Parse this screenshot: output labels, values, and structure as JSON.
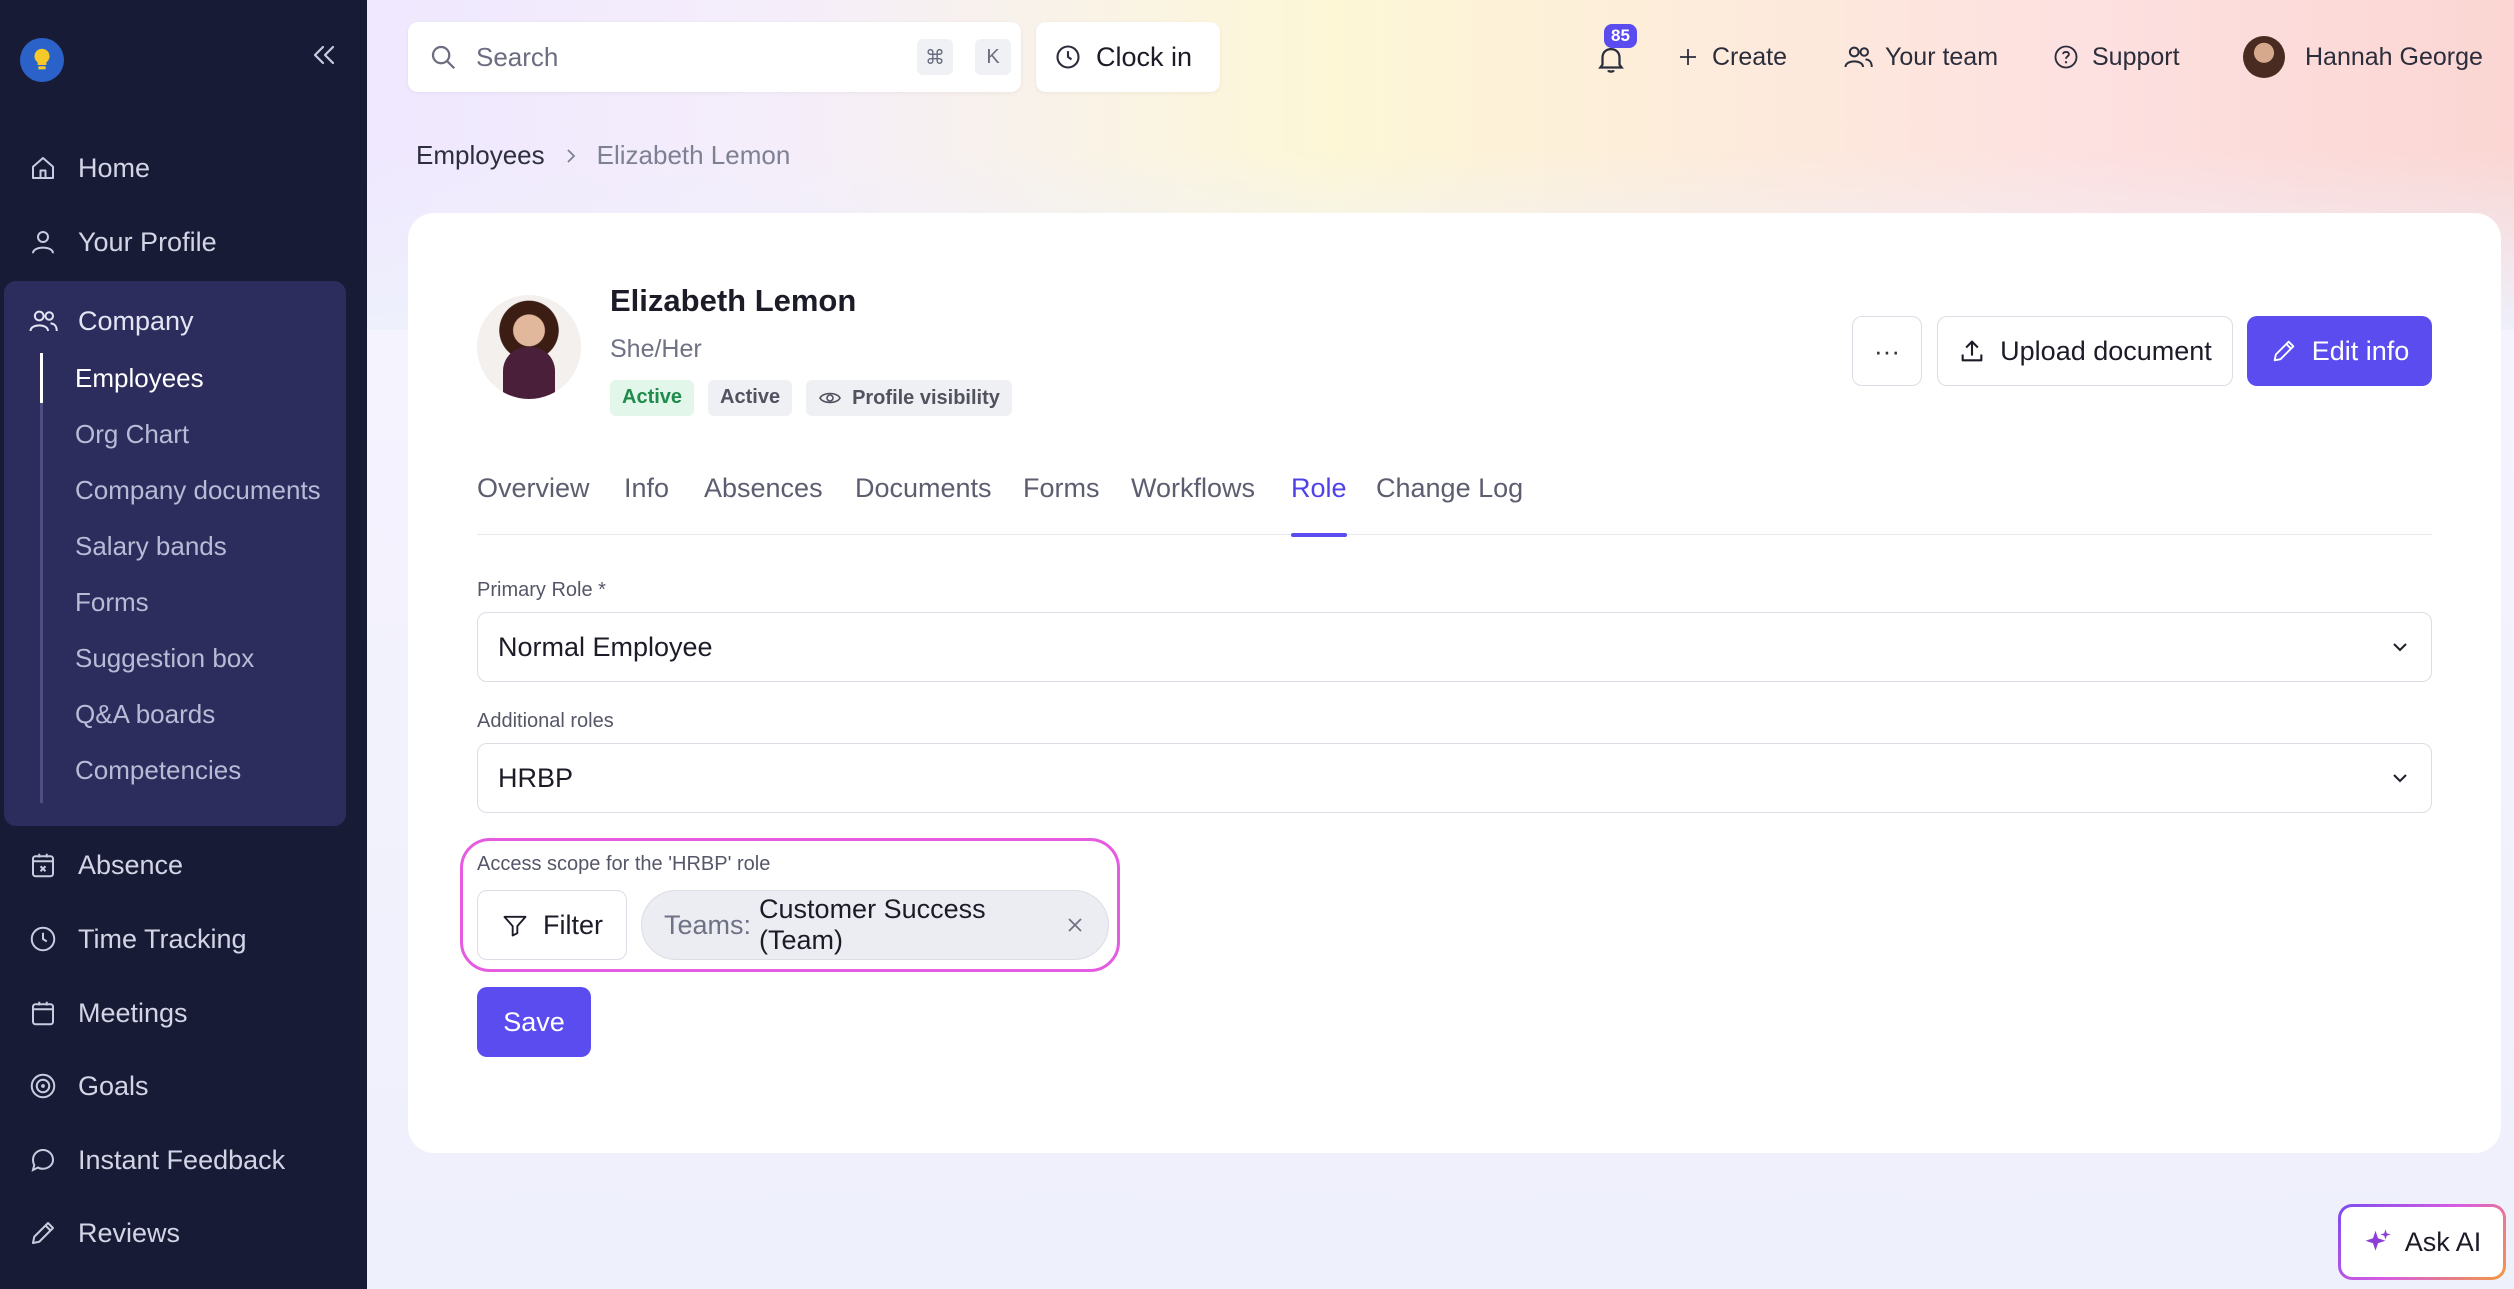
{
  "sidebar": {
    "nav": [
      {
        "label": "Home",
        "icon": "home-icon"
      },
      {
        "label": "Your Profile",
        "icon": "user-icon"
      }
    ],
    "company": {
      "label": "Company",
      "icon": "users-icon",
      "items": [
        "Employees",
        "Org Chart",
        "Company documents",
        "Salary bands",
        "Forms",
        "Suggestion box",
        "Q&A boards",
        "Competencies"
      ],
      "active_item": "Employees"
    },
    "nav_bottom": [
      {
        "label": "Absence",
        "icon": "calendar-x-icon"
      },
      {
        "label": "Time Tracking",
        "icon": "clock-icon"
      },
      {
        "label": "Meetings",
        "icon": "calendar-icon"
      },
      {
        "label": "Goals",
        "icon": "target-icon"
      },
      {
        "label": "Instant Feedback",
        "icon": "chat-bubble-icon"
      },
      {
        "label": "Reviews",
        "icon": "pencil-icon"
      }
    ]
  },
  "topbar": {
    "search_placeholder": "Search",
    "shortcut_keys": [
      "⌘",
      "K"
    ],
    "clock_in": "Clock in",
    "notifications_count": "85",
    "create": "Create",
    "your_team": "Your team",
    "support": "Support",
    "user_name": "Hannah George"
  },
  "breadcrumb": {
    "parent": "Employees",
    "current": "Elizabeth Lemon"
  },
  "profile": {
    "name": "Elizabeth Lemon",
    "pronouns": "She/Her",
    "tags": [
      "Active",
      "Active"
    ],
    "visibility": "Profile visibility",
    "more": "···",
    "upload": "Upload document",
    "edit": "Edit info"
  },
  "tabs": [
    "Overview",
    "Info",
    "Absences",
    "Documents",
    "Forms",
    "Workflows",
    "Role",
    "Change Log"
  ],
  "active_tab": "Role",
  "form": {
    "primary_role_label": "Primary Role *",
    "primary_role_value": "Normal Employee",
    "additional_roles_label": "Additional roles",
    "additional_roles_value": "HRBP",
    "scope_label": "Access scope for the 'HRBP' role",
    "filter": "Filter",
    "chip_key": "Teams:",
    "chip_value": "Customer Success (Team)",
    "save": "Save"
  },
  "ask_ai": "Ask AI",
  "colors": {
    "accent": "#5b4cf0",
    "sidebar": "#181b35",
    "highlight": "#e55ce0"
  }
}
